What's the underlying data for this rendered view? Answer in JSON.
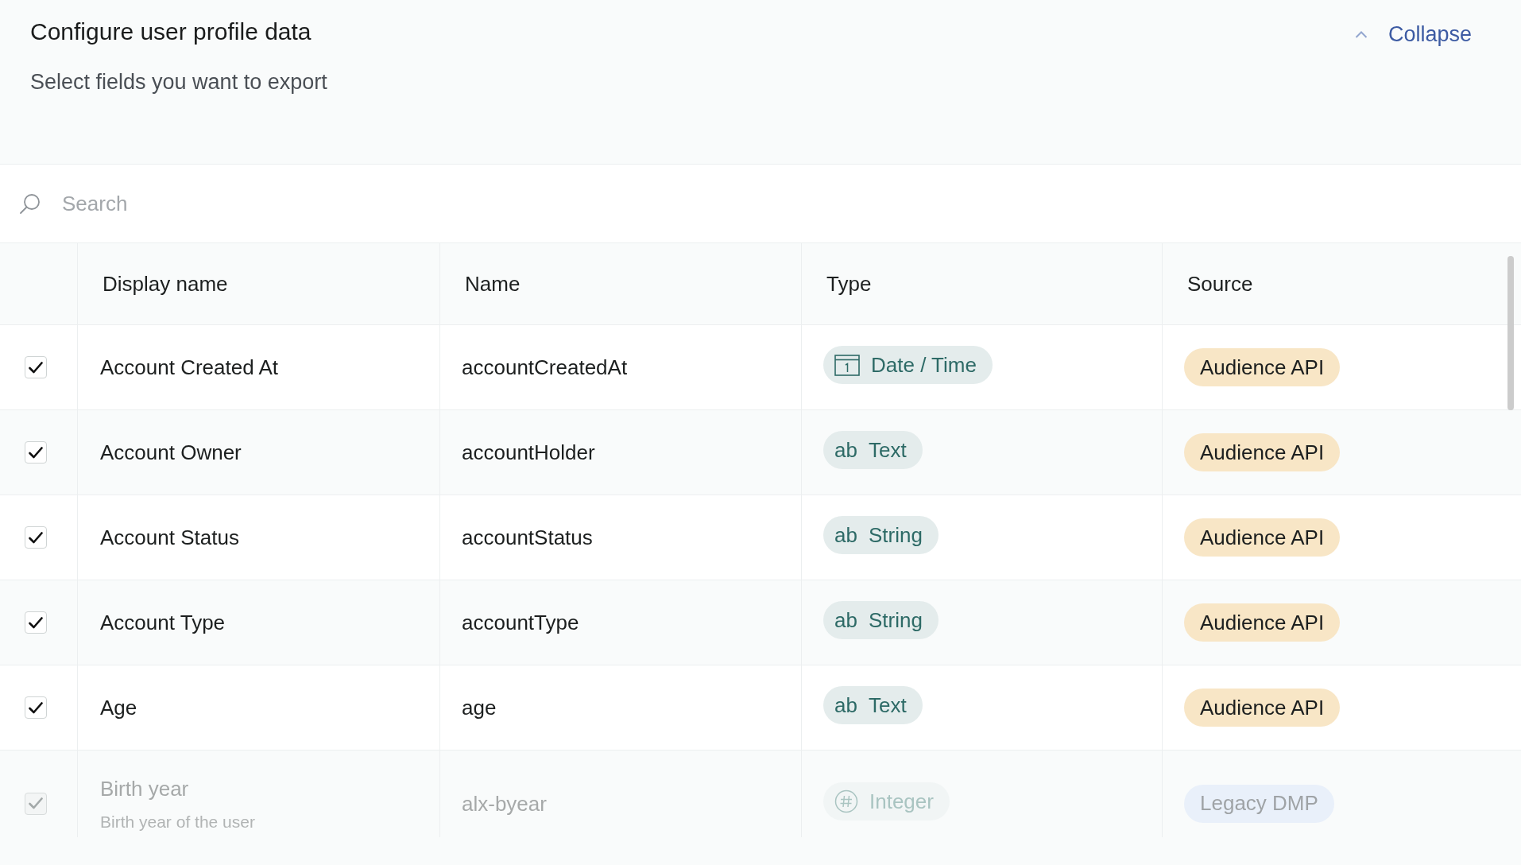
{
  "panel": {
    "title": "Configure user profile data",
    "subtitle": "Select fields you want to export",
    "collapse_label": "Collapse"
  },
  "search": {
    "placeholder": "Search"
  },
  "table": {
    "columns": [
      "Display name",
      "Name",
      "Type",
      "Source"
    ],
    "rows": [
      {
        "checked": true,
        "disabled": false,
        "display_name": "Account Created At",
        "name": "accountCreatedAt",
        "type": {
          "kind": "date",
          "label": "Date / Time"
        },
        "source": {
          "label": "Audience API",
          "color": "#f8e6c6"
        }
      },
      {
        "checked": true,
        "disabled": false,
        "display_name": "Account Owner",
        "name": "accountHolder",
        "type": {
          "kind": "text",
          "icon_label": "ab",
          "label": "Text"
        },
        "source": {
          "label": "Audience API",
          "color": "#f8e6c6"
        }
      },
      {
        "checked": true,
        "disabled": false,
        "display_name": "Account Status",
        "name": "accountStatus",
        "type": {
          "kind": "text",
          "icon_label": "ab",
          "label": "String"
        },
        "source": {
          "label": "Audience API",
          "color": "#f8e6c6"
        }
      },
      {
        "checked": true,
        "disabled": false,
        "display_name": "Account Type",
        "name": "accountType",
        "type": {
          "kind": "text",
          "icon_label": "ab",
          "label": "String"
        },
        "source": {
          "label": "Audience API",
          "color": "#f8e6c6"
        }
      },
      {
        "checked": true,
        "disabled": false,
        "display_name": "Age",
        "name": "age",
        "type": {
          "kind": "text",
          "icon_label": "ab",
          "label": "Text"
        },
        "source": {
          "label": "Audience API",
          "color": "#f8e6c6"
        }
      },
      {
        "checked": true,
        "disabled": true,
        "display_name": "Birth year",
        "description": "Birth year of the user",
        "name": "alx-byear",
        "type": {
          "kind": "number",
          "label": "Integer"
        },
        "source": {
          "label": "Legacy DMP",
          "color": "#e9f0fa"
        }
      }
    ]
  }
}
